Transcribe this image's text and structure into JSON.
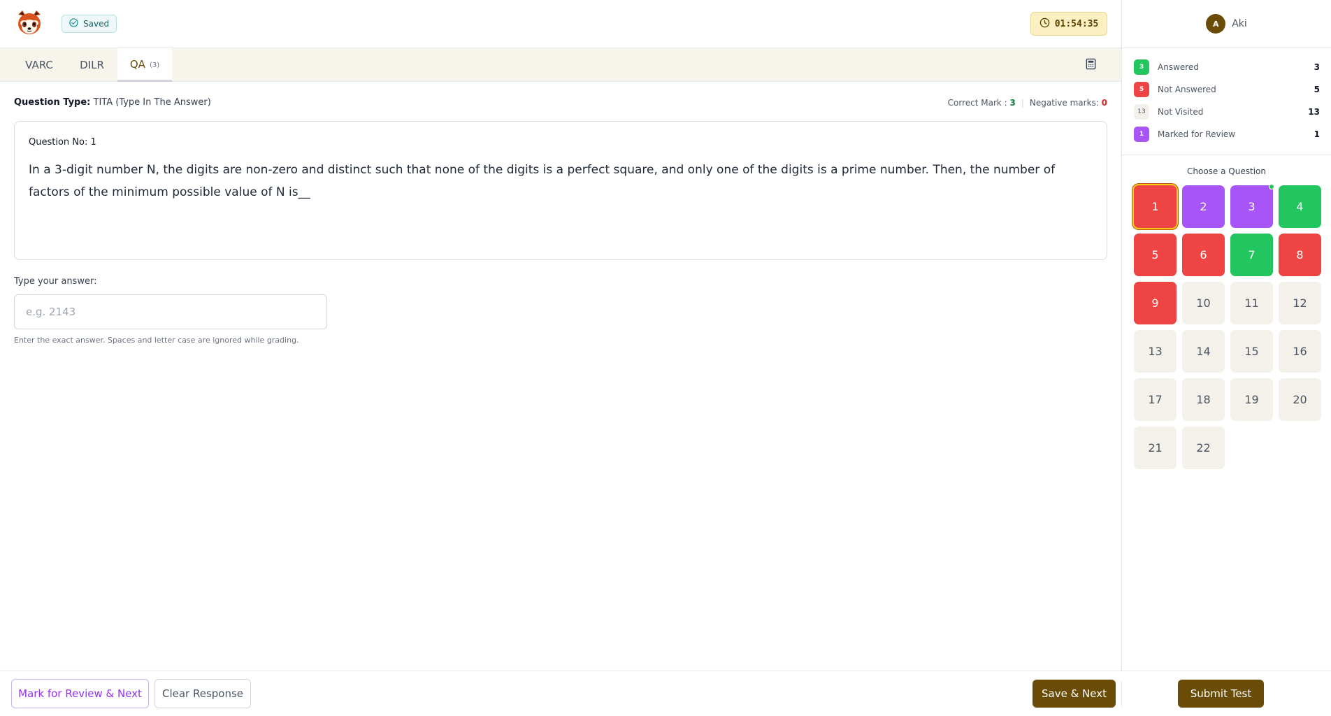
{
  "header": {
    "saved_label": "Saved",
    "timer": "01:54:35",
    "user_initial": "A",
    "user_name": "Aki"
  },
  "tabs": [
    {
      "label": "VARC",
      "count": ""
    },
    {
      "label": "DILR",
      "count": ""
    },
    {
      "label": "QA",
      "count": "(3)"
    }
  ],
  "question": {
    "type_label": "Question Type:",
    "type_value": "TITA (Type In The Answer)",
    "correct_label": "Correct Mark :",
    "correct_value": "3",
    "negative_label": "Negative marks:",
    "negative_value": "0",
    "number_label": "Question No: 1",
    "text": "In a 3-digit number N, the digits are non-zero and distinct such that none of the digits is a perfect square, and only one of the digits is a prime number. Then, the number of factors of the minimum possible value of N is__"
  },
  "answer": {
    "label": "Type your answer:",
    "placeholder": "e.g. 2143",
    "value": "",
    "hint": "Enter the exact answer. Spaces and letter case are ignored while grading."
  },
  "legend": [
    {
      "badge": "3",
      "label": "Answered",
      "count": "3",
      "color": "#22c55e"
    },
    {
      "badge": "5",
      "label": "Not Answered",
      "count": "5",
      "color": "#ef4444"
    },
    {
      "badge": "13",
      "label": "Not Visited",
      "count": "13",
      "color": "#f4f1ea"
    },
    {
      "badge": "1",
      "label": "Marked for Review",
      "count": "1",
      "color": "#a855f7"
    }
  ],
  "palette": {
    "title": "Choose a Question",
    "questions": [
      {
        "n": "1",
        "status": "not-answered",
        "current": true
      },
      {
        "n": "2",
        "status": "review"
      },
      {
        "n": "3",
        "status": "review",
        "dot": true
      },
      {
        "n": "4",
        "status": "answered"
      },
      {
        "n": "5",
        "status": "not-answered"
      },
      {
        "n": "6",
        "status": "not-answered"
      },
      {
        "n": "7",
        "status": "answered"
      },
      {
        "n": "8",
        "status": "not-answered"
      },
      {
        "n": "9",
        "status": "not-answered"
      },
      {
        "n": "10",
        "status": "not-visited"
      },
      {
        "n": "11",
        "status": "not-visited"
      },
      {
        "n": "12",
        "status": "not-visited"
      },
      {
        "n": "13",
        "status": "not-visited"
      },
      {
        "n": "14",
        "status": "not-visited"
      },
      {
        "n": "15",
        "status": "not-visited"
      },
      {
        "n": "16",
        "status": "not-visited"
      },
      {
        "n": "17",
        "status": "not-visited"
      },
      {
        "n": "18",
        "status": "not-visited"
      },
      {
        "n": "19",
        "status": "not-visited"
      },
      {
        "n": "20",
        "status": "not-visited"
      },
      {
        "n": "21",
        "status": "not-visited"
      },
      {
        "n": "22",
        "status": "not-visited"
      }
    ]
  },
  "footer": {
    "review_label": "Mark for Review & Next",
    "clear_label": "Clear Response",
    "save_label": "Save & Next",
    "submit_label": "Submit Test"
  },
  "colors": {
    "brand": "#6b4c06",
    "answered": "#22c55e",
    "not_answered": "#ef4444",
    "review": "#a855f7",
    "not_visited": "#f4f1ea"
  },
  "icons": {
    "logo": "red-panda-logo",
    "saved": "check-circle-icon",
    "timer": "clock-icon",
    "calculator": "calculator-icon"
  }
}
